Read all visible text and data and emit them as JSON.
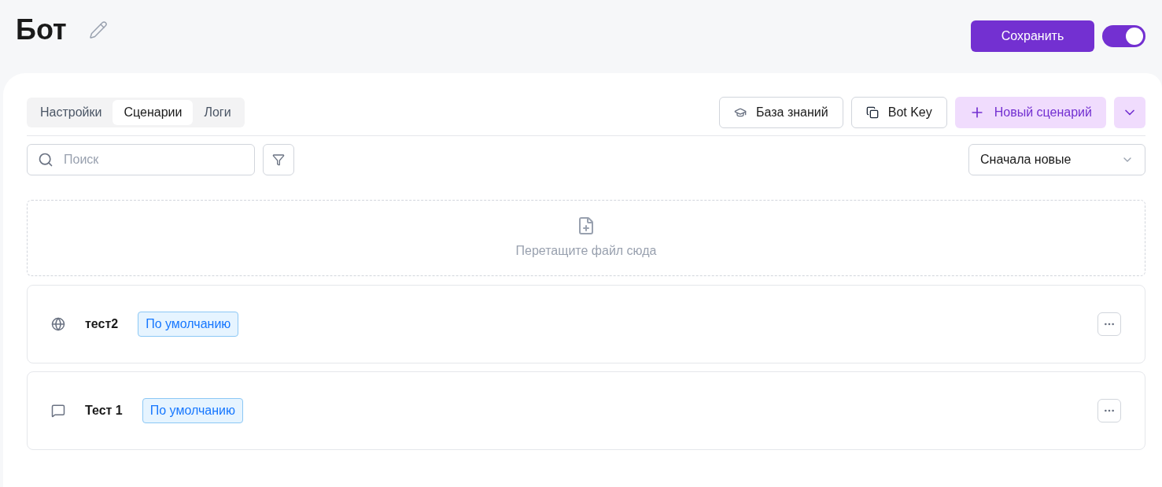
{
  "title": "Бот",
  "save_button": "Сохранить",
  "enabled_toggle": {
    "on": true
  },
  "tabs": [
    {
      "label": "Настройки",
      "selected": false
    },
    {
      "label": "Сценарии",
      "selected": true
    },
    {
      "label": "Логи",
      "selected": false
    }
  ],
  "toolbar_buttons": [
    {
      "kind": "knowledge",
      "label": "База знаний"
    },
    {
      "kind": "key",
      "label": "Bot Key"
    }
  ],
  "new_scenario_button": "Новый сценарий",
  "search": {
    "placeholder": "Поиск"
  },
  "sort_select": {
    "value": "Сначала новые"
  },
  "drop_zone": "Перетащите файл сюда",
  "scenarios": [
    {
      "kind": "web",
      "name": "тест2",
      "badge": "По умолчанию"
    },
    {
      "kind": "chat",
      "name": "Тест 1",
      "badge": "По умолчанию"
    }
  ]
}
